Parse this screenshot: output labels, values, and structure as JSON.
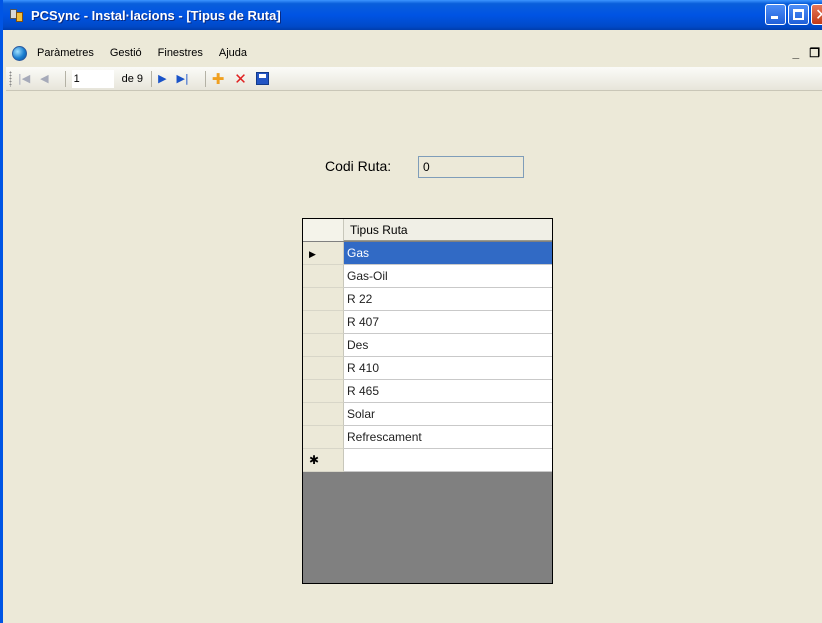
{
  "window": {
    "title": "PCSync - Instal·lacions - [Tipus de Ruta]"
  },
  "menubar": {
    "items": [
      "Paràmetres",
      "Gestió",
      "Finestres",
      "Ajuda"
    ]
  },
  "navigator": {
    "position": "1",
    "count_label": "de 9"
  },
  "form": {
    "codi_label": "Codi Ruta:",
    "codi_value": "0"
  },
  "grid": {
    "column_header": "Tipus Ruta",
    "rows": [
      "Gas",
      "Gas-Oil",
      "R 22",
      "R 407",
      "Des",
      "R 410",
      "R 465",
      "Solar",
      "Refrescament"
    ],
    "selected_index": 0,
    "current_row_marker": "▶",
    "new_row_marker": "✱"
  },
  "colors": {
    "selection": "#316ac5",
    "titlebar": "#0054e3",
    "form_background": "#ece9d8"
  }
}
